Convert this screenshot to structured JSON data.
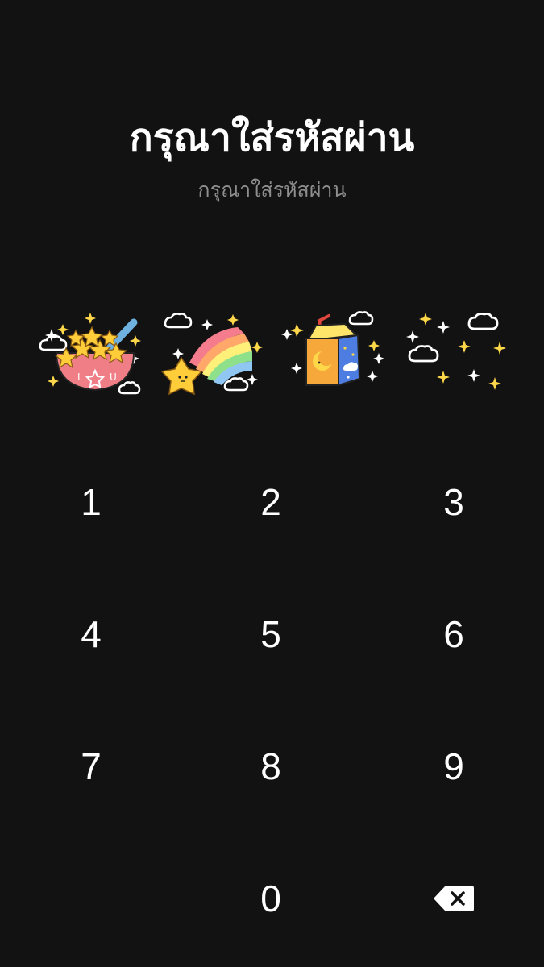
{
  "lock_screen": {
    "title": "กรุณาใส่รหัสผ่าน",
    "subtitle": "กรุณาใส่รหัสผ่าน"
  },
  "pin_slots": [
    {
      "icon": "cereal-bowl-sticker-icon"
    },
    {
      "icon": "rainbow-shooting-star-sticker-icon"
    },
    {
      "icon": "juice-box-sticker-icon"
    },
    {
      "icon": "clouds-sparkles-sticker-icon"
    }
  ],
  "keypad": {
    "keys": [
      "1",
      "2",
      "3",
      "4",
      "5",
      "6",
      "7",
      "8",
      "9",
      "0"
    ],
    "backspace_icon": "backspace-icon"
  },
  "colors": {
    "background": "#121212",
    "title": "#ffffff",
    "subtitle": "#8e8e8e"
  }
}
